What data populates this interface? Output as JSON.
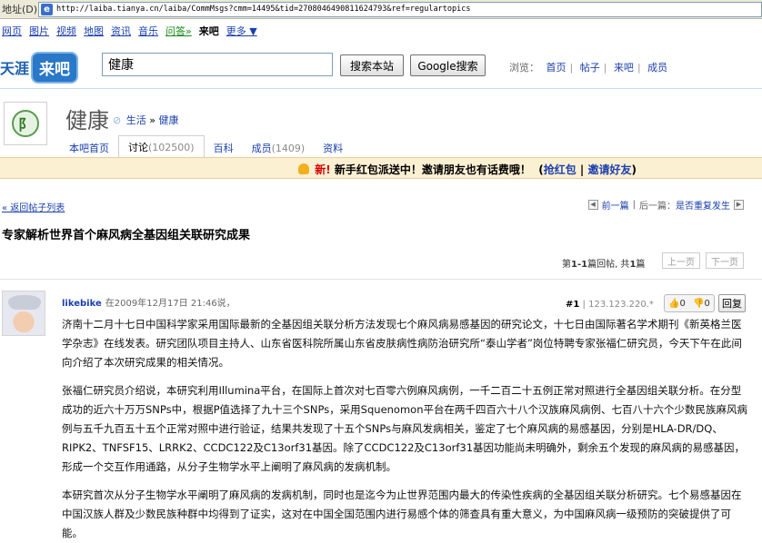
{
  "address_bar": {
    "label": "地址(D)",
    "url": "http://laiba.tianya.cn/laiba/CommMsgs?cmm=14495&tid=2708046490811624793&ref=regulartopics"
  },
  "portal_nav": {
    "items": [
      "网页",
      "图片",
      "视频",
      "地图",
      "资讯",
      "音乐"
    ],
    "answer": "问答»",
    "current": "来吧",
    "more": "更多 ▼"
  },
  "header": {
    "logo_tianya": "天涯",
    "logo_laiba": "来吧",
    "search_value": "健康",
    "search_local_btn": "搜索本站",
    "search_google_btn": "Google搜索",
    "browse_label": "浏览：",
    "browse_links": [
      "首页",
      "帖子",
      "来吧",
      "成员"
    ]
  },
  "bar": {
    "avatar_glyph": "阝",
    "name": "健康",
    "category_parent": "生活",
    "category_sep": "»",
    "category_child": "健康",
    "tabs": [
      {
        "label": "本吧首页",
        "count": ""
      },
      {
        "label": "讨论",
        "count": "(102500)"
      },
      {
        "label": "百科",
        "count": ""
      },
      {
        "label": "成员",
        "count": "(1409)"
      },
      {
        "label": "资料",
        "count": ""
      }
    ]
  },
  "promo": {
    "new_label": "新!",
    "text": "新手红包派送中！邀请朋友也有话费哦！",
    "link1": "抢红包",
    "sep": "|",
    "link2": "邀请好友"
  },
  "list_nav": {
    "back": "« 返回帖子列表",
    "prev": "前一篇",
    "next_label": "后一篇：",
    "next_title": "是否重复发生"
  },
  "post_title": "专家解析世界首个麻风病全基因组关联研究成果",
  "pagination": {
    "info_prefix": "第",
    "range": "1-1",
    "info_mid": "篇回帖, 共",
    "total": "1",
    "info_suffix": "篇",
    "prev_btn": "上一页",
    "next_btn": "下一页"
  },
  "post": {
    "author": "likebike",
    "time": "在2009年12月17日 21:46说，",
    "floor": "#1",
    "ip": "123.123.220.*",
    "vote_up": "0",
    "vote_down": "0",
    "reply": "回复",
    "paragraphs": [
      "济南十二月十七日中国科学家采用国际最新的全基因组关联分析方法发现七个麻风病易感基因的研究论文，十七日由国际著名学术期刊《新英格兰医学杂志》在线发表。研究团队项目主持人、山东省医科院所属山东省皮肤病性病防治研究所“泰山学者”岗位特聘专家张福仁研究员，今天下午在此间向介绍了本次研究成果的相关情况。",
      "张福仁研究员介绍说，本研究利用Illumina平台，在国际上首次对七百零六例麻风病例，一千二百二十五例正常对照进行全基因组关联分析。在分型成功的近六十万万SNPs中，根据P值选择了九十三个SNPs，采用Squenomon平台在两千四百六十八个汉族麻风病例、七百八十六个少数民族麻风病例与五千九百五十五个正常对照中进行验证，结果共发现了十五个SNPs与麻风发病相关，鉴定了七个麻风病的易感基因，分别是HLA-DR/DQ、RIPK2、TNFSF15、LRRK2、CCDC122及C13orf31基因。除了CCDC122及C13orf31基因功能尚未明确外，剩余五个发现的麻风病的易感基因，形成一个交互作用通路，从分子生物学水平上阐明了麻风病的发病机制。",
      "本研究首次从分子生物学水平阐明了麻风病的发病机制，同时也是迄今为止世界范围内最大的传染性疾病的全基因组关联分析研究。七个易感基因在中国汉族人群及少数民族种群中均得到了证实，这对在中国全国范围内进行易感个体的筛查具有重大意义，为中国麻风病一级预防的突破提供了可能。"
    ]
  }
}
